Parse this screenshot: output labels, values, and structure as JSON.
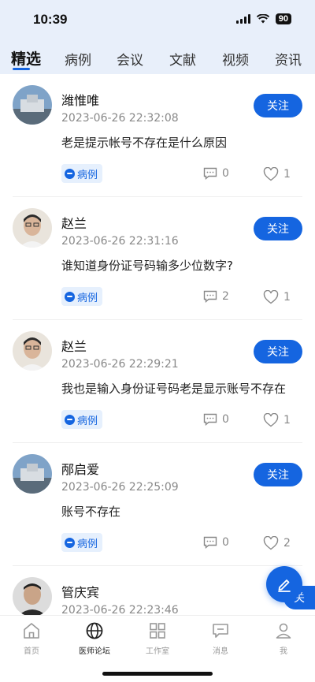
{
  "status": {
    "time": "10:39",
    "battery": "90"
  },
  "tabs": [
    {
      "label": "精选",
      "active": true
    },
    {
      "label": "病例"
    },
    {
      "label": "会议"
    },
    {
      "label": "文献"
    },
    {
      "label": "视频"
    },
    {
      "label": "资讯"
    }
  ],
  "posts": [
    {
      "username": "潍惟唯",
      "timestamp": "2023-06-26 22:32:08",
      "content": "老是提示帐号不存在是什么原因",
      "tag": "病例",
      "comments": "0",
      "likes": "1",
      "follow": "关注"
    },
    {
      "username": "赵兰",
      "timestamp": "2023-06-26 22:31:16",
      "content": "谁知道身份证号码输多少位数字?",
      "tag": "病例",
      "comments": "2",
      "likes": "1",
      "follow": "关注"
    },
    {
      "username": "赵兰",
      "timestamp": "2023-06-26 22:29:21",
      "content": "我也是输入身份证号码老是显示账号不存在",
      "tag": "病例",
      "comments": "0",
      "likes": "1",
      "follow": "关注"
    },
    {
      "username": "邴启爱",
      "timestamp": "2023-06-26 22:25:09",
      "content": "账号不存在",
      "tag": "病例",
      "comments": "0",
      "likes": "2",
      "follow": "关注"
    },
    {
      "username": "管庆宾",
      "timestamp": "2023-06-26 22:23:46",
      "content": "",
      "tag": "",
      "comments": "",
      "likes": "",
      "follow": "关"
    }
  ],
  "bottom_nav": [
    {
      "label": "首页",
      "icon": "home-icon"
    },
    {
      "label": "医师论坛",
      "icon": "globe-icon",
      "active": true
    },
    {
      "label": "工作室",
      "icon": "grid-icon"
    },
    {
      "label": "消息",
      "icon": "message-icon"
    },
    {
      "label": "我",
      "icon": "user-icon"
    }
  ],
  "colors": {
    "accent": "#1565e0",
    "header_bg": "#e8effa"
  }
}
